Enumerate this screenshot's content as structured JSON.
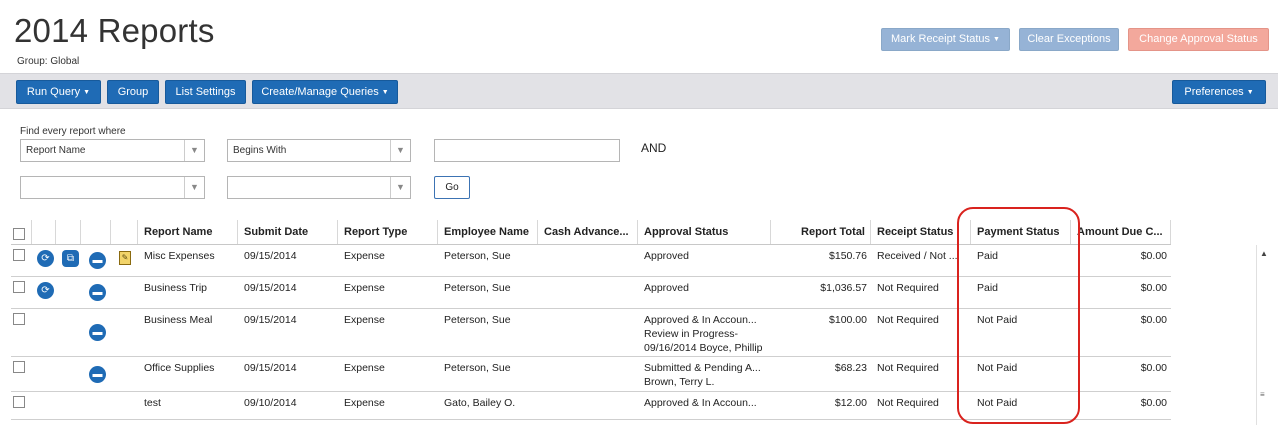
{
  "page": {
    "title": "2014 Reports",
    "group": "Group: Global"
  },
  "top_buttons": {
    "mark_receipt": "Mark Receipt Status",
    "clear_exceptions": "Clear Exceptions",
    "change_approval": "Change Approval Status"
  },
  "toolbar": {
    "run_query": "Run Query",
    "group": "Group",
    "list_settings": "List Settings",
    "create_manage": "Create/Manage Queries",
    "preferences": "Preferences"
  },
  "query": {
    "find_label": "Find every report where",
    "field": "Report Name",
    "operator": "Begins With",
    "value": "",
    "and_label": "AND",
    "field2": "",
    "operator2": "",
    "go": "Go"
  },
  "table": {
    "headers": {
      "report_name": "Report Name",
      "submit_date": "Submit Date",
      "report_type": "Report Type",
      "employee_name": "Employee Name",
      "cash_advance": "Cash Advance...",
      "approval_status": "Approval Status",
      "report_total": "Report Total",
      "receipt_status": "Receipt Status",
      "payment_status": "Payment Status",
      "amount_due": "Amount Due C..."
    },
    "rows": [
      {
        "name": "Misc Expenses",
        "date": "09/15/2014",
        "type": "Expense",
        "employee": "Peterson, Sue",
        "cash": "",
        "approval": [
          "Approved"
        ],
        "total": "$150.76",
        "receipt": "Received / Not ...",
        "payment": "Paid",
        "amount_due": "$0.00"
      },
      {
        "name": "Business Trip",
        "date": "09/15/2014",
        "type": "Expense",
        "employee": "Peterson, Sue",
        "cash": "",
        "approval": [
          "Approved"
        ],
        "total": "$1,036.57",
        "receipt": "Not Required",
        "payment": "Paid",
        "amount_due": "$0.00"
      },
      {
        "name": "Business Meal",
        "date": "09/15/2014",
        "type": "Expense",
        "employee": "Peterson, Sue",
        "cash": "",
        "approval": [
          "Approved & In Accoun...",
          "Review in Progress-",
          "09/16/2014 Boyce, Phillip"
        ],
        "total": "$100.00",
        "receipt": "Not Required",
        "payment": "Not Paid",
        "amount_due": "$0.00"
      },
      {
        "name": "Office Supplies",
        "date": "09/15/2014",
        "type": "Expense",
        "employee": "Peterson, Sue",
        "cash": "",
        "approval": [
          "Submitted & Pending A...",
          "Brown, Terry L."
        ],
        "total": "$68.23",
        "receipt": "Not Required",
        "payment": "Not Paid",
        "amount_due": "$0.00"
      },
      {
        "name": "test",
        "date": "09/10/2014",
        "type": "Expense",
        "employee": "Gato, Bailey O.",
        "cash": "",
        "approval": [
          "Approved & In Accoun..."
        ],
        "total": "$12.00",
        "receipt": "Not Required",
        "payment": "Not Paid",
        "amount_due": "$0.00"
      }
    ]
  },
  "colors": {
    "primary": "#1f6bb5",
    "disabled_blue": "#96b3d6",
    "disabled_red": "#f3a89c",
    "highlight": "#d9231e"
  }
}
